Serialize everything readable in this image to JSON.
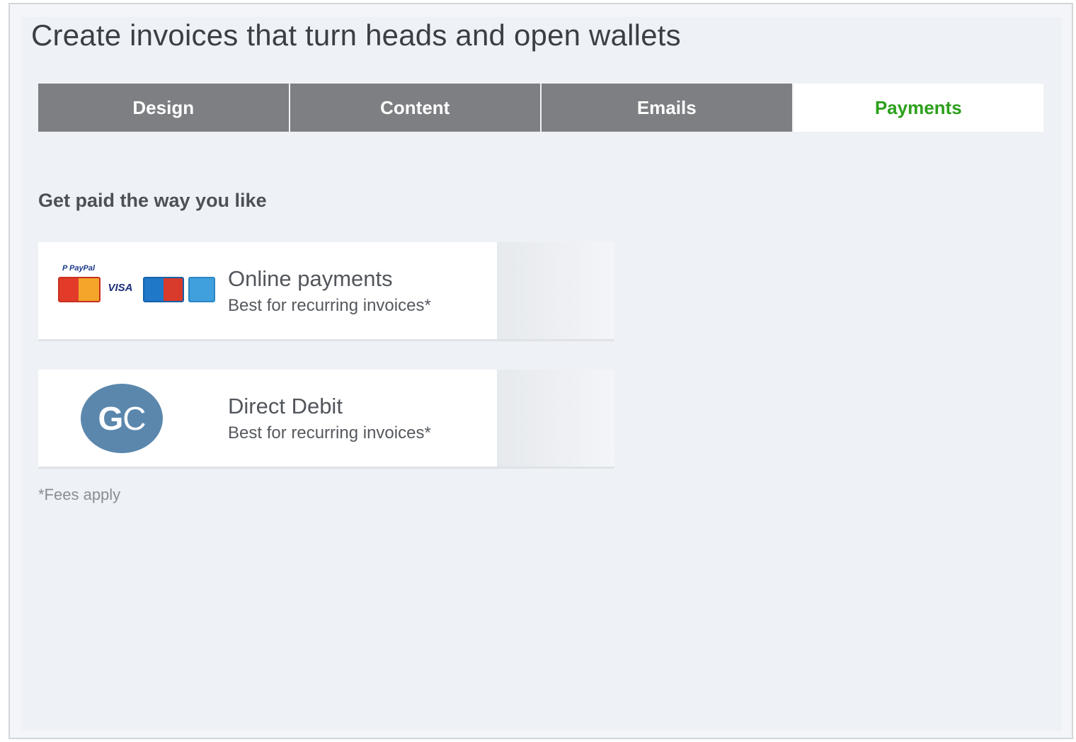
{
  "page": {
    "title": "Create invoices that turn heads and open wallets"
  },
  "tabs": [
    {
      "label": "Design",
      "active": false
    },
    {
      "label": "Content",
      "active": false
    },
    {
      "label": "Emails",
      "active": false
    },
    {
      "label": "Payments",
      "active": true
    }
  ],
  "payments": {
    "heading": "Get paid the way you like",
    "options": [
      {
        "name": "Online payments",
        "description": "Best for recurring invoices*",
        "logo": "card-brands-logo",
        "logo_labels": {
          "paypal": "P PayPal",
          "visa": "VISA"
        }
      },
      {
        "name": "Direct Debit",
        "description": "Best for recurring invoices*",
        "logo": "gocardless-logo",
        "logo_labels": {
          "g": "G",
          "c": "C"
        }
      }
    ],
    "footnote": "*Fees apply"
  },
  "colors": {
    "tab_inactive_bg": "#7d7f82",
    "tab_active_text": "#2ca01c",
    "gc_badge": "#5b87ad"
  }
}
